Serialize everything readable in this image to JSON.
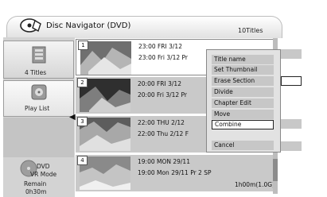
{
  "header": {
    "title": "Disc Navigator (DVD)",
    "count": "10Titles"
  },
  "sidebar": {
    "titles_label": "4 Titles",
    "playlist_label": "Play List",
    "disc_type_1": "DVD",
    "disc_type_2": "VR Mode",
    "remain_label": "Remain",
    "remain_time": "0h30m"
  },
  "rows": [
    {
      "num": "1",
      "line1": "23:00 FRI 3/12",
      "line2": "23:00  Fri  3/12  Pr",
      "size": ""
    },
    {
      "num": "2",
      "line1": "20:00  FRI  3/12",
      "line2": "20:00   Fri  3/12  Pr",
      "size": ""
    },
    {
      "num": "3",
      "line1": "22:00  THU  2/12",
      "line2": "22:00   Thu  2/12  F",
      "size": ""
    },
    {
      "num": "4",
      "line1": "19:00  MON  29/11",
      "line2": "19:00  Mon  29/11  Pr 2  SP",
      "size": "1h00m(1.0G)"
    }
  ],
  "menu": {
    "items": [
      "Title name",
      "Set Thumbnail",
      "Erase Section",
      "Divide",
      "Chapter Edit",
      "Move",
      "Combine",
      "Cancel"
    ],
    "active": "Combine"
  },
  "colors": {
    "background": "#ffffff",
    "panel": "#d3d3d3",
    "row": "#c9c9c9",
    "menu_item": "#c7c7c7"
  }
}
